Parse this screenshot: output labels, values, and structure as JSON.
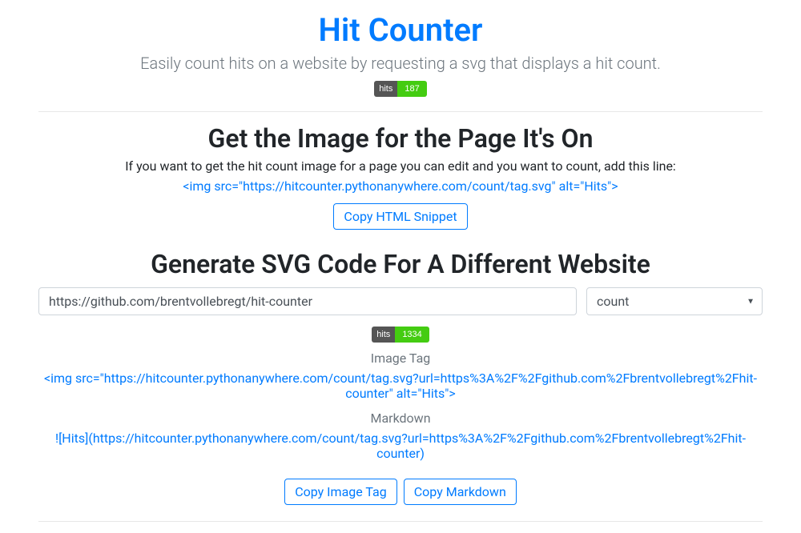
{
  "header": {
    "title": "Hit Counter",
    "subtitle": "Easily count hits on a website by requesting a svg that displays a hit count.",
    "badge_label": "hits",
    "badge_value": "187"
  },
  "section1": {
    "title": "Get the Image for the Page It's On",
    "description": "If you want to get the hit count image for a page you can edit and you want to count, add this line:",
    "snippet": "<img src=\"https://hitcounter.pythonanywhere.com/count/tag.svg\" alt=\"Hits\">",
    "copy_button": "Copy HTML Snippet"
  },
  "section2": {
    "title": "Generate SVG Code For A Different Website",
    "url_value": "https://github.com/brentvollebregt/hit-counter",
    "select_value": "count",
    "badge_label": "hits",
    "badge_value": "1334",
    "image_tag_label": "Image Tag",
    "image_tag_code": "<img src=\"https://hitcounter.pythonanywhere.com/count/tag.svg?url=https%3A%2F%2Fgithub.com%2Fbrentvollebregt%2Fhit-counter\" alt=\"Hits\">",
    "markdown_label": "Markdown",
    "markdown_code": "![Hits](https://hitcounter.pythonanywhere.com/count/tag.svg?url=https%3A%2F%2Fgithub.com%2Fbrentvollebregt%2Fhit-counter)",
    "copy_image_button": "Copy Image Tag",
    "copy_markdown_button": "Copy Markdown"
  }
}
